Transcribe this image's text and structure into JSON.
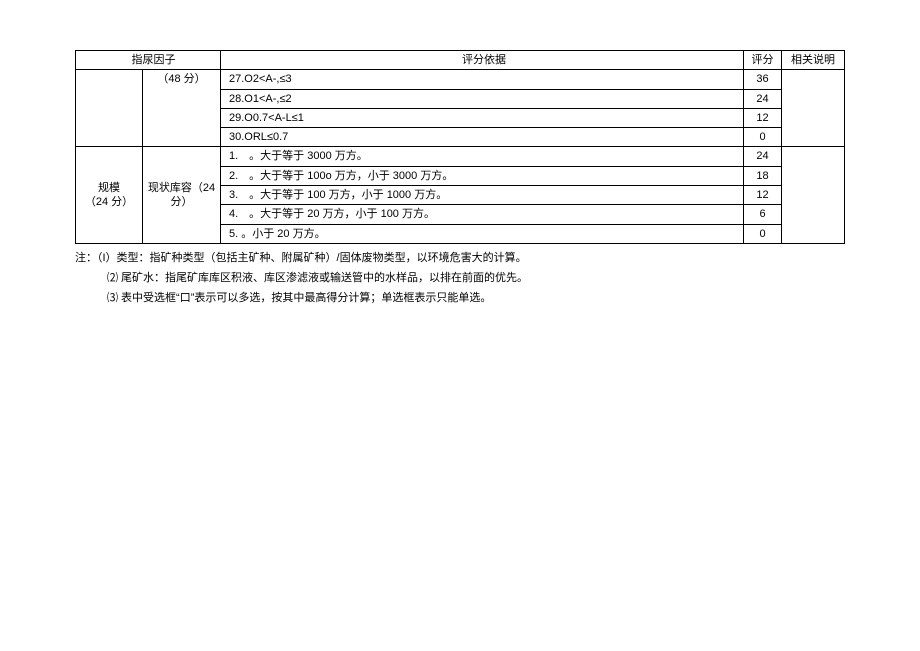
{
  "table": {
    "headers": {
      "indicator_prefix": "指",
      "factor_suffix": "尿因子",
      "basis": "评分依据",
      "score": "评分",
      "note": "相关说明"
    },
    "group1": {
      "col2_text": "（48 分）",
      "rows": [
        {
          "basis": "27.O2<A-,≤3",
          "score": "36"
        },
        {
          "basis": "28.O1<A-,≤2",
          "score": "24"
        },
        {
          "basis": "29.O0.7<A-L≤1",
          "score": "12"
        },
        {
          "basis": "30.ORL≤0.7",
          "score": "0"
        }
      ]
    },
    "group2": {
      "col1_line1": "规模",
      "col1_line2": "（24 分）",
      "col2_text": "现状库容（24 分）",
      "rows": [
        {
          "basis": "1.　。大于等于 3000 万方。",
          "score": "24"
        },
        {
          "basis": "2.　。大于等于 100o 万方，小于 3000 万方。",
          "score": "18"
        },
        {
          "basis": "3.　。大于等于 100 万方，小于 1000 万方。",
          "score": "12"
        },
        {
          "basis": "4.　。大于等于 20 万方，小于 100 万方。",
          "score": "6"
        },
        {
          "basis": "5. 。小于 20 万方。",
          "score": "0"
        }
      ]
    }
  },
  "notes": {
    "n1": "注：（I）类型：指矿种类型（包括主矿种、附属矿种）/固体废物类型，以环境危害大的计算。",
    "n2": "⑵ 尾矿水：指尾矿库库区积液、库区渗滤液或输送管中的水样品，以排在前面的优先。",
    "n3": "⑶ 表中受选框“口”表示可以多选，按其中最高得分计算；单选框表示只能单选。"
  }
}
